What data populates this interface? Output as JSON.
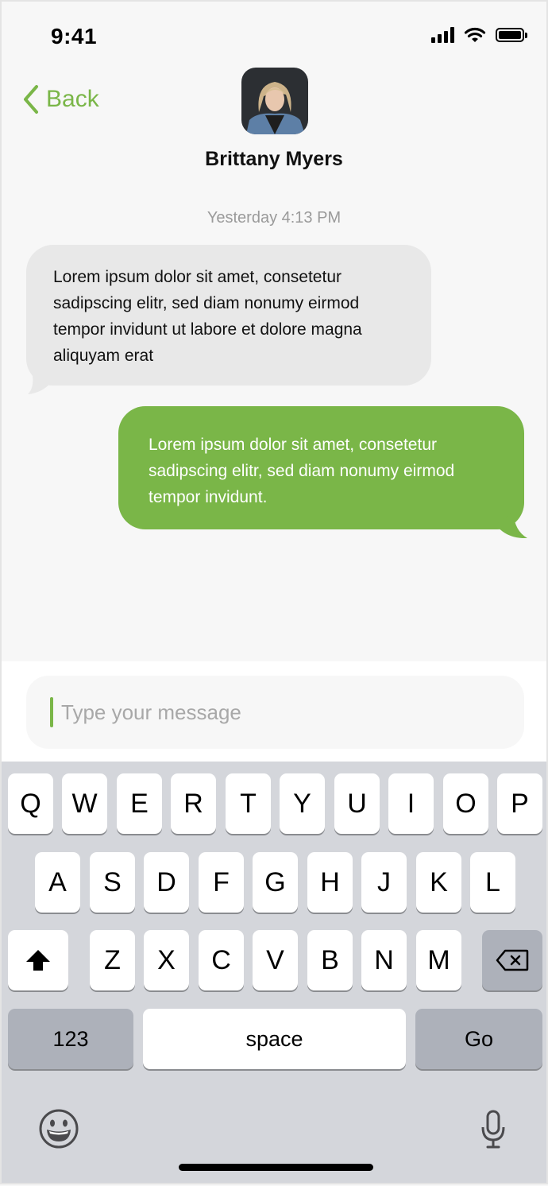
{
  "status_bar": {
    "time": "9:41"
  },
  "nav": {
    "back_label": "Back"
  },
  "contact": {
    "name": "Brittany Myers"
  },
  "conversation": {
    "timestamp": "Yesterday 4:13 PM",
    "messages": [
      {
        "direction": "incoming",
        "text": "Lorem ipsum dolor sit amet, consetetur sadipscing elitr, sed diam nonumy eirmod tempor invidunt ut labore et dolore magna aliquyam erat"
      },
      {
        "direction": "outgoing",
        "text": "Lorem ipsum dolor sit amet, consetetur sadipscing elitr, sed diam nonumy eirmod tempor invidunt."
      }
    ]
  },
  "composer": {
    "placeholder": "Type your message"
  },
  "keyboard": {
    "row1": [
      "Q",
      "W",
      "E",
      "R",
      "T",
      "Y",
      "U",
      "I",
      "O",
      "P"
    ],
    "row2": [
      "A",
      "S",
      "D",
      "F",
      "G",
      "H",
      "J",
      "K",
      "L"
    ],
    "row3": [
      "Z",
      "X",
      "C",
      "V",
      "B",
      "N",
      "M"
    ],
    "numbers_label": "123",
    "space_label": "space",
    "go_label": "Go"
  },
  "colors": {
    "accent": "#7ab648",
    "incoming_bubble": "#e8e8e8",
    "keyboard_bg": "#d4d6db"
  },
  "icons": [
    "back-chevron-icon",
    "signal-icon",
    "wifi-icon",
    "battery-icon",
    "shift-icon",
    "backspace-icon",
    "emoji-icon",
    "microphone-icon"
  ]
}
